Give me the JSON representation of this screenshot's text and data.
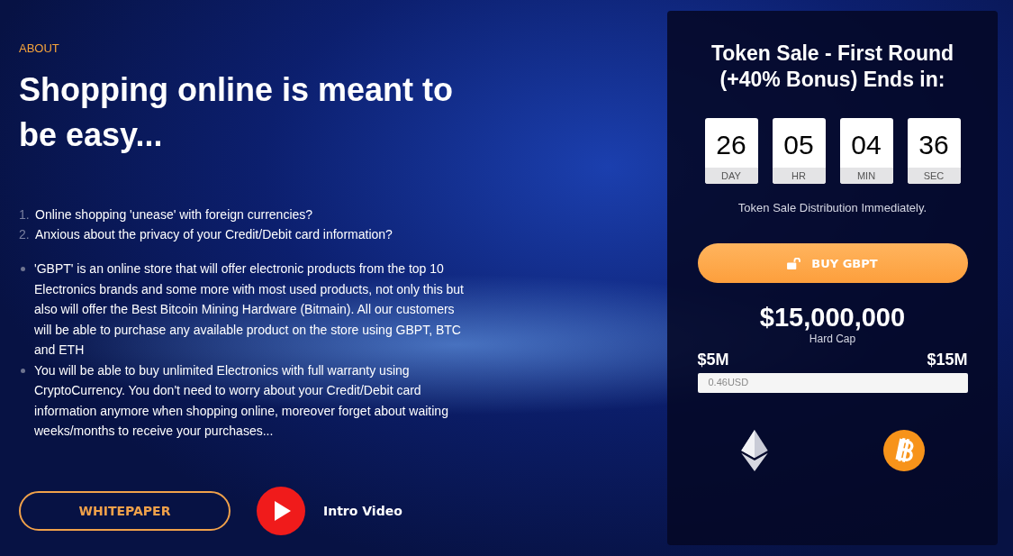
{
  "about": {
    "eyebrow": "ABOUT",
    "heading": "Shopping online is meant to be easy...",
    "questions": [
      {
        "number": "1.",
        "text": "Online shopping 'unease' with foreign currencies?"
      },
      {
        "number": "2.",
        "text": "Anxious about the privacy of your Credit/Debit card information?"
      }
    ],
    "points": [
      "'GBPT' is an online store that will offer electronic products from the top 10 Electronics brands and some more with most used products, not only this but also will offer the Best Bitcoin Mining Hardware (Bitmain). All our customers will be able to purchase any available product on the store using GBPT, BTC and ETH",
      "You will be able to buy unlimited Electronics with full warranty using CryptoCurrency. You don't need to worry about your Credit/Debit card information anymore when shopping online, moreover forget about waiting weeks/months to receive your purchases..."
    ],
    "whitepaper_button": "WHITEPAPER",
    "video_label": "Intro Video"
  },
  "sale": {
    "title": "Token Sale - First Round (+40% Bonus) Ends in:",
    "countdown": [
      {
        "value": "26",
        "unit": "DAY"
      },
      {
        "value": "05",
        "unit": "HR"
      },
      {
        "value": "04",
        "unit": "MIN"
      },
      {
        "value": "36",
        "unit": "SEC"
      }
    ],
    "note": "Token Sale Distribution Immediately.",
    "buy_button": "BUY GBPT",
    "hard_cap": "$15,000,000",
    "hard_cap_label": "Hard Cap",
    "min": "$5M",
    "max": "$15M",
    "progress": {
      "level": 0,
      "label": "0.46USD"
    }
  }
}
